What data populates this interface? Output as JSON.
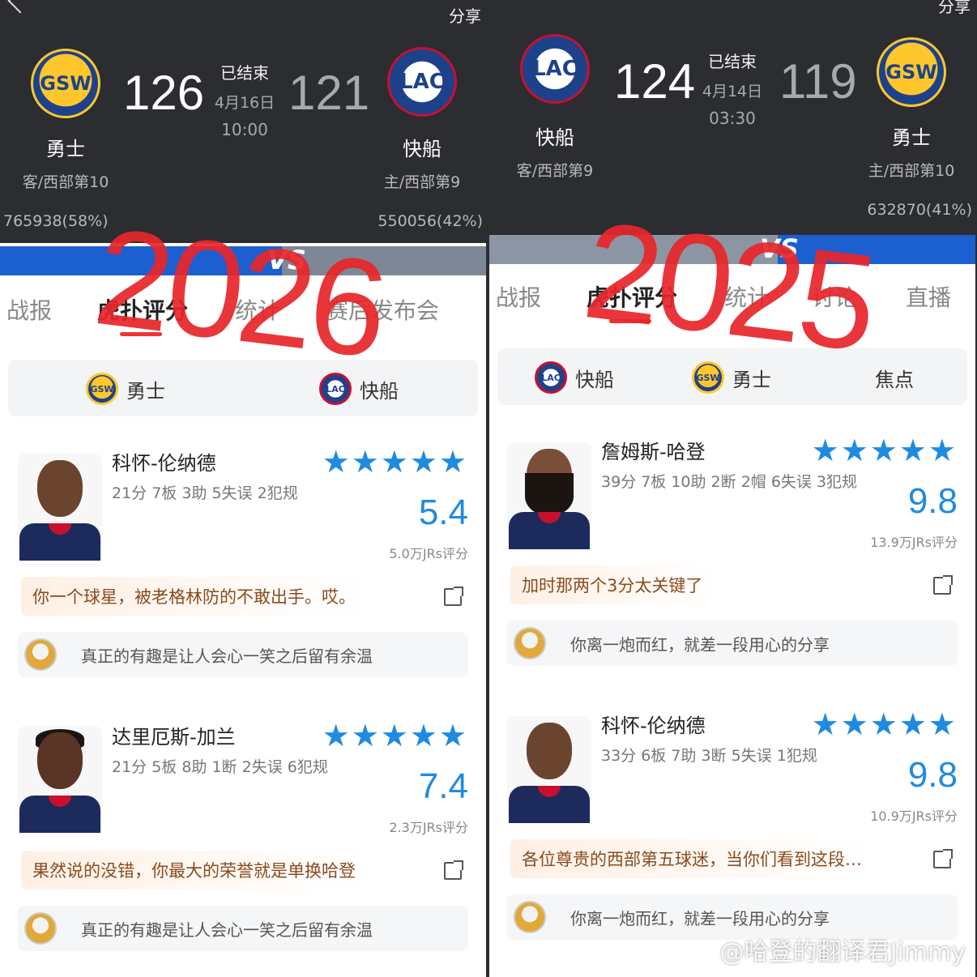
{
  "left": {
    "share": "分享",
    "team1": {
      "abbr": "GSW",
      "name": "勇士",
      "sub": "客/西部第10",
      "score": "126",
      "votes": "765938(58%)"
    },
    "team2": {
      "abbr": "LAC",
      "name": "快船",
      "sub": "主/西部第9",
      "score": "121",
      "votes": "550056(42%)"
    },
    "status": "已结束",
    "date": "4月16日",
    "time": "10:00",
    "vs": "VS",
    "tabs": [
      "战报",
      "虎扑评分",
      "统计",
      "赛后发布会"
    ],
    "subtabs": [
      "勇士",
      "快船"
    ],
    "year": "2026",
    "players": [
      {
        "name": "科怀-伦纳德",
        "stats": "21分 7板 3助 5失误 2犯规",
        "stars": "★★★★★",
        "rating": "5.4",
        "count": "5.0万JRs评分",
        "comment": "你一个球星，被老格林防的不敢出手。哎。",
        "reply": "真正的有趣是让人会心一笑之后留有余温"
      },
      {
        "name": "达里厄斯-加兰",
        "stats": "21分 5板 8助 1断 2失误 6犯规",
        "stars": "★★★★★",
        "rating": "7.4",
        "count": "2.3万JRs评分",
        "comment": "果然说的没错，你最大的荣誉就是单换哈登",
        "reply": "真正的有趣是让人会心一笑之后留有余温"
      }
    ]
  },
  "right": {
    "share": "分享",
    "team1": {
      "abbr": "LAC",
      "name": "快船",
      "sub": "客/西部第9",
      "score": "124"
    },
    "team2": {
      "abbr": "GSW",
      "name": "勇士",
      "sub": "主/西部第10",
      "score": "119",
      "votes": "632870(41%)"
    },
    "status": "已结束",
    "date": "4月14日",
    "time": "03:30",
    "vs": "VS",
    "tabs": [
      "战报",
      "虎扑评分",
      "统计",
      "讨论",
      "直播"
    ],
    "subtabs": [
      "快船",
      "勇士",
      "焦点"
    ],
    "year": "2025",
    "players": [
      {
        "name": "詹姆斯-哈登",
        "stats": "39分 7板 10助 2断 2帽 6失误 3犯规",
        "stars": "★★★★★",
        "rating": "9.8",
        "count": "13.9万JRs评分",
        "comment": "加时那两个3分太关键了",
        "reply": "你离一炮而红，就差一段用心的分享"
      },
      {
        "name": "科怀-伦纳德",
        "stats": "33分 6板 7助 3断 5失误 1犯规",
        "stars": "★★★★★",
        "rating": "9.8",
        "count": "10.9万JRs评分",
        "comment": "各位尊贵的西部第五球迷，当你们看到这段…",
        "reply": "你离一炮而红，就差一段用心的分享"
      }
    ]
  },
  "watermark": "@哈登的翻译君Jimmy",
  "colors": {
    "header_bg": "#2b2d31",
    "accent_blue": "#1f8be0",
    "year_red": "#e8262a",
    "vs_blue": "#1c5fd1"
  }
}
